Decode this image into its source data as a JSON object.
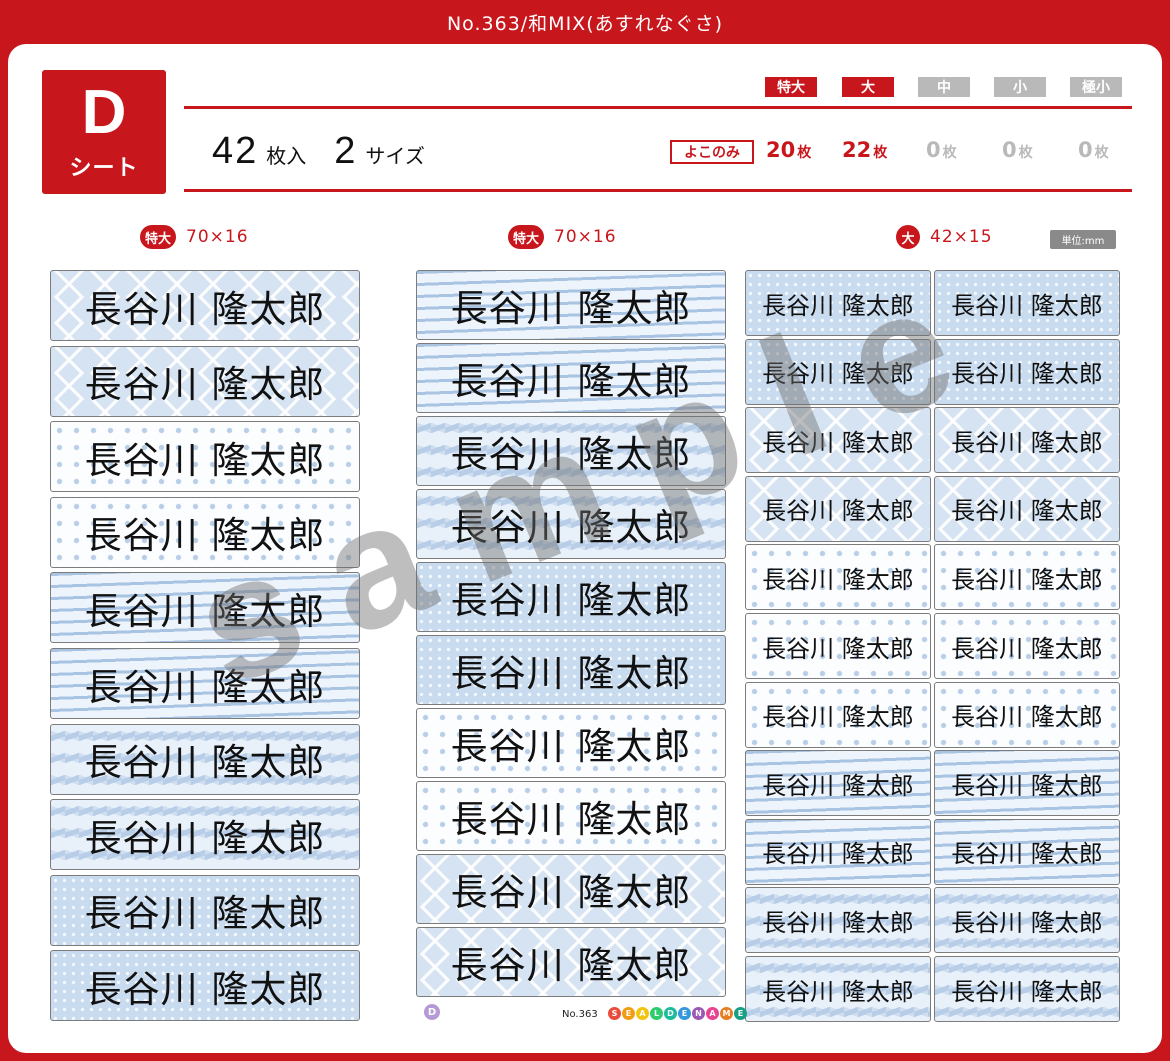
{
  "header": {
    "title": "No.363/和MIX(あすれなぐさ)"
  },
  "sheet": {
    "letter": "D",
    "word": "シート"
  },
  "summary": {
    "count": "42",
    "count_unit": "枚入",
    "sizes": "2",
    "sizes_unit": "サイズ"
  },
  "size_tags": [
    {
      "label": "特大",
      "active": true
    },
    {
      "label": "大",
      "active": true
    },
    {
      "label": "中",
      "active": false
    },
    {
      "label": "小",
      "active": false
    },
    {
      "label": "極小",
      "active": false
    }
  ],
  "yoko_label": "よこのみ",
  "counts": [
    {
      "n": "20",
      "unit": "枚"
    },
    {
      "n": "22",
      "unit": "枚"
    },
    {
      "n": "0",
      "unit": "枚"
    },
    {
      "n": "0",
      "unit": "枚"
    },
    {
      "n": "0",
      "unit": "枚"
    }
  ],
  "columns": [
    {
      "tag": "特大",
      "dims": "70×16"
    },
    {
      "tag": "特大",
      "dims": "70×16"
    },
    {
      "tag": "大",
      "dims": "42×15"
    }
  ],
  "unit_note": "単位:mm",
  "label_name": "長谷川 隆太郎",
  "col1_patterns": [
    "diamond",
    "diamond",
    "dots",
    "dots",
    "stripes",
    "stripes",
    "arrow",
    "arrow",
    "speckle",
    "speckle"
  ],
  "col2_patterns": [
    "stripes",
    "stripes",
    "arrow",
    "arrow",
    "speckle",
    "speckle",
    "dots",
    "dots",
    "diamond",
    "diamond"
  ],
  "col3_patterns": [
    "speckle",
    "speckle",
    "diamond",
    "diamond",
    "dots",
    "dots",
    "dots",
    "stripes",
    "stripes",
    "arrow",
    "arrow"
  ],
  "watermark": "sample",
  "footer": {
    "d": "D",
    "no": "No.363",
    "brand": "SEALDENAME"
  }
}
